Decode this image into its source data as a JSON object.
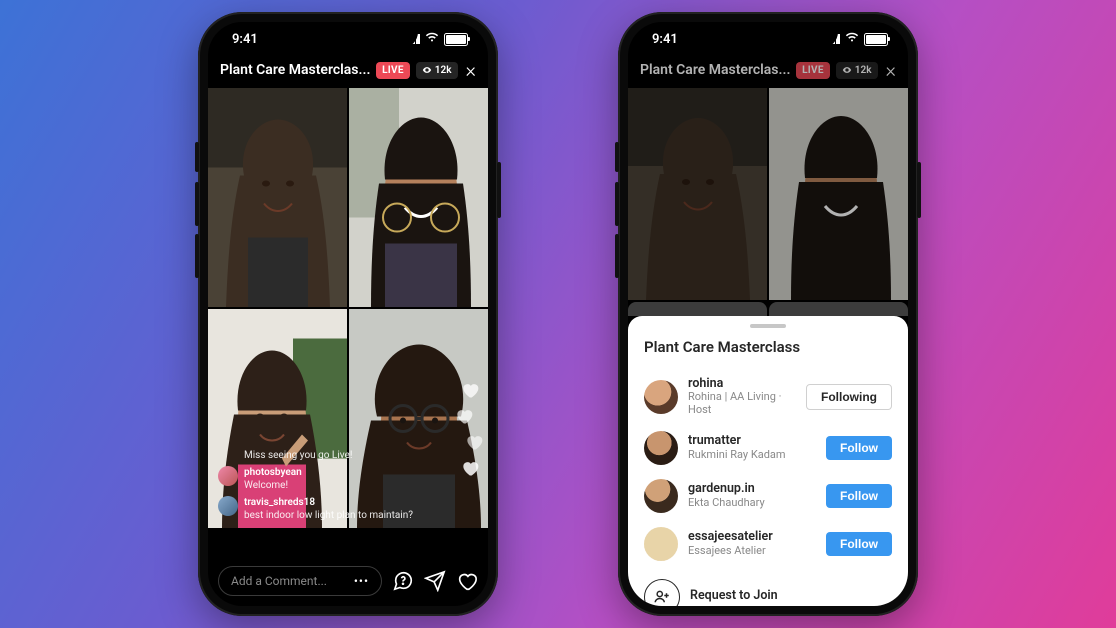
{
  "status": {
    "time": "9:41"
  },
  "live": {
    "title": "Plant Care Masterclas...",
    "live_label": "LIVE",
    "viewers": "12k",
    "comments": [
      {
        "name": "",
        "body": "Miss seeing you go Live!"
      },
      {
        "name": "photosbyean",
        "body": "Welcome!"
      },
      {
        "name": "travis_shreds18",
        "body": "best indoor low light plan to maintain?"
      }
    ],
    "input_placeholder": "Add a Comment..."
  },
  "sheet": {
    "title": "Plant Care Masterclass",
    "rows": [
      {
        "name": "rohina",
        "sub": "Rohina | AA Living · Host",
        "btn": "Following",
        "btn_type": "following"
      },
      {
        "name": "trumatter",
        "sub": "Rukmini Ray Kadam",
        "btn": "Follow",
        "btn_type": "follow"
      },
      {
        "name": "gardenup.in",
        "sub": "Ekta Chaudhary",
        "btn": "Follow",
        "btn_type": "follow"
      },
      {
        "name": "essajeesatelier",
        "sub": "Essajees Atelier",
        "btn": "Follow",
        "btn_type": "follow"
      }
    ],
    "request_label": "Request to Join"
  },
  "colors": {
    "accent": "#ed4956",
    "follow": "#3897f0"
  }
}
